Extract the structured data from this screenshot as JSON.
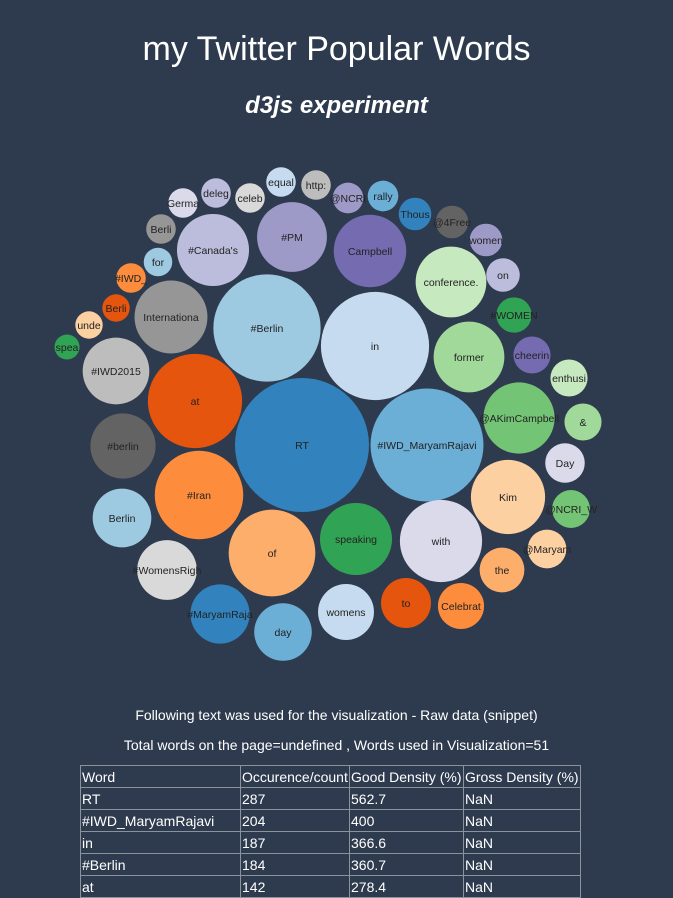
{
  "page": {
    "title": "my Twitter Popular Words",
    "subtitle": "d3js experiment",
    "raw_caption": "Following text was used for the visualization - Raw data (snippet)",
    "totals": "Total words on the page=undefined , Words used in Visualization=51"
  },
  "table": {
    "headers": [
      "Word",
      "Occurence/count",
      "Good Density (%)",
      "Gross Density (%)"
    ],
    "rows": [
      [
        "RT",
        "287",
        "562.7",
        "NaN"
      ],
      [
        "#IWD_MaryamRajavi",
        "204",
        "400",
        "NaN"
      ],
      [
        "in",
        "187",
        "366.6",
        "NaN"
      ],
      [
        "#Berlin",
        "184",
        "360.7",
        "NaN"
      ],
      [
        "at",
        "142",
        "278.4",
        "NaN"
      ]
    ]
  },
  "chart_data": {
    "type": "bubble",
    "color_scheme": "category20c",
    "bubbles": [
      {
        "label": "RT",
        "value": 287,
        "color": "#3182bd",
        "text_color": "#222222"
      },
      {
        "label": "#IWD_MaryamRajavi",
        "value": 204,
        "color": "#6baed6",
        "text_color": "#222222"
      },
      {
        "label": "in",
        "value": 187,
        "color": "#c6dbef",
        "text_color": "#222222"
      },
      {
        "label": "#Berlin",
        "value": 184,
        "color": "#9ecae1",
        "text_color": "#222222"
      },
      {
        "label": "at",
        "value": 142,
        "color": "#e6550d",
        "text_color": "#222222"
      },
      {
        "label": "#Iran",
        "value": 125,
        "color": "#fd8d3c",
        "text_color": "#222222"
      },
      {
        "label": "of",
        "value": 120,
        "color": "#fdae6b",
        "text_color": "#222222"
      },
      {
        "label": "with",
        "value": 108,
        "color": "#dadaeb",
        "text_color": "#222222"
      },
      {
        "label": "Kim",
        "value": 88,
        "color": "#fdd0a2",
        "text_color": "#222222"
      },
      {
        "label": "Internationa",
        "value": 85,
        "color": "#969696",
        "text_color": "#222222"
      },
      {
        "label": "Campbell",
        "value": 84,
        "color": "#756bb1",
        "text_color": "#222222"
      },
      {
        "label": "#Canada's",
        "value": 83,
        "color": "#bcbddc",
        "text_color": "#222222"
      },
      {
        "label": "speaking",
        "value": 83,
        "color": "#31a354",
        "text_color": "#222222"
      },
      {
        "label": "former",
        "value": 80,
        "color": "#a1d99b",
        "text_color": "#222222"
      },
      {
        "label": "#PM",
        "value": 78,
        "color": "#9e9ac8",
        "text_color": "#222222"
      },
      {
        "label": "conference.",
        "value": 80,
        "color": "#c7e9c0",
        "text_color": "#222222"
      },
      {
        "label": "@AKimCampbell",
        "value": 81,
        "color": "#74c476",
        "text_color": "#222222"
      },
      {
        "label": "#berlin",
        "value": 68,
        "color": "#636363",
        "text_color": "#222222"
      },
      {
        "label": "#WomensRigh",
        "value": 57,
        "color": "#d9d9d9",
        "text_color": "#222222"
      },
      {
        "label": "#IWD2015",
        "value": 71,
        "color": "#bdbdbd",
        "text_color": "#222222"
      },
      {
        "label": "Berlin",
        "value": 55,
        "color": "#9ecae1",
        "text_color": "#222222"
      },
      {
        "label": "womens",
        "value": 50,
        "color": "#c6dbef",
        "text_color": "#222222"
      },
      {
        "label": "#MaryamRaja",
        "value": 56,
        "color": "#3182bd",
        "text_color": "#222222"
      },
      {
        "label": "day",
        "value": 53,
        "color": "#6baed6",
        "text_color": "#222222"
      },
      {
        "label": "to",
        "value": 40,
        "color": "#e6550d",
        "text_color": "#222222"
      },
      {
        "label": "Celebrat",
        "value": 34,
        "color": "#fd8d3c",
        "text_color": "#222222"
      },
      {
        "label": "the",
        "value": 32,
        "color": "#fdae6b",
        "text_color": "#222222"
      },
      {
        "label": "cheerin",
        "value": 22,
        "color": "#756bb1",
        "text_color": "#222222"
      },
      {
        "label": "Day",
        "value": 25,
        "color": "#dadaeb",
        "text_color": "#222222"
      },
      {
        "label": "&",
        "value": 22,
        "color": "#a1d99b",
        "text_color": "#222222"
      },
      {
        "label": "@NCRI_W",
        "value": 23,
        "color": "#74c476",
        "text_color": "#222222"
      },
      {
        "label": "enthusi",
        "value": 22,
        "color": "#c7e9c0",
        "text_color": "#222222"
      },
      {
        "label": "@Maryam",
        "value": 24,
        "color": "#fdd0a2",
        "text_color": "#222222"
      },
      {
        "label": "#WOMEN",
        "value": 20,
        "color": "#31a354",
        "text_color": "#222222"
      },
      {
        "label": "on",
        "value": 18,
        "color": "#bcbddc",
        "text_color": "#222222"
      },
      {
        "label": "women",
        "value": 17,
        "color": "#9e9ac8",
        "text_color": "#222222"
      },
      {
        "label": "@4Free",
        "value": 17,
        "color": "#636363",
        "text_color": "#222222"
      },
      {
        "label": "Thous",
        "value": 17,
        "color": "#3182bd",
        "text_color": "#222222"
      },
      {
        "label": "rally",
        "value": 15,
        "color": "#6baed6",
        "text_color": "#222222"
      },
      {
        "label": "@NCRI",
        "value": 15,
        "color": "#9e9ac8",
        "text_color": "#222222"
      },
      {
        "label": "http:",
        "value": 14,
        "color": "#bdbdbd",
        "text_color": "#222222"
      },
      {
        "label": "equal",
        "value": 14,
        "color": "#c6dbef",
        "text_color": "#222222"
      },
      {
        "label": "celeb",
        "value": 14,
        "color": "#d9d9d9",
        "text_color": "#222222"
      },
      {
        "label": "deleg",
        "value": 14,
        "color": "#bcbddc",
        "text_color": "#222222"
      },
      {
        "label": "Germa",
        "value": 14,
        "color": "#dadaeb",
        "text_color": "#222222"
      },
      {
        "label": "Berli",
        "value": 14,
        "color": "#969696",
        "text_color": "#222222"
      },
      {
        "label": "for",
        "value": 13,
        "color": "#9ecae1",
        "text_color": "#222222"
      },
      {
        "label": "#IWD_",
        "value": 14,
        "color": "#fd8d3c",
        "text_color": "#222222"
      },
      {
        "label": "Berli",
        "value": 12,
        "color": "#e6550d",
        "text_color": "#222222"
      },
      {
        "label": "unde",
        "value": 12,
        "color": "#fdd0a2",
        "text_color": "#222222"
      },
      {
        "label": "spea",
        "value": 10,
        "color": "#31a354",
        "text_color": "#222222"
      }
    ]
  }
}
